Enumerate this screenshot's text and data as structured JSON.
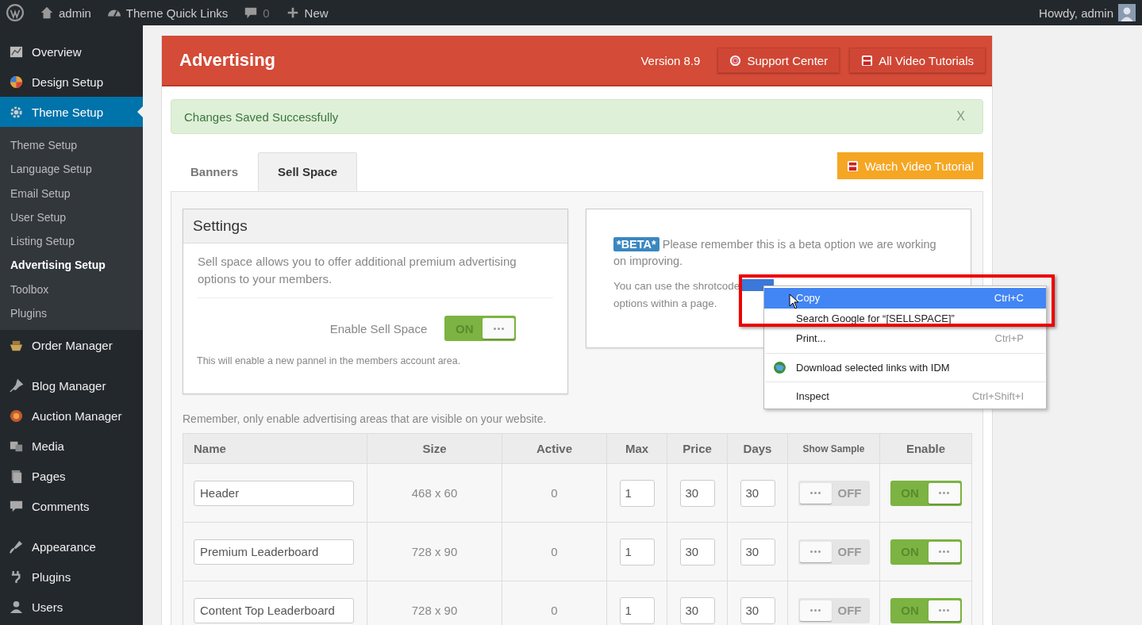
{
  "admin_bar": {
    "items": [
      {
        "kind": "wp"
      },
      {
        "kind": "home",
        "label": "admin"
      },
      {
        "kind": "gauge",
        "label": "Theme Quick Links"
      },
      {
        "kind": "comment",
        "label": "0"
      },
      {
        "kind": "plus",
        "label": "New"
      }
    ],
    "greeting": "Howdy, admin"
  },
  "sidebar": {
    "items": [
      {
        "kind": "chart",
        "label": "Overview",
        "selected": false
      },
      {
        "kind": "palette",
        "label": "Design Setup",
        "selected": false
      },
      {
        "kind": "gear",
        "label": "Theme Setup",
        "selected": true,
        "children": [
          {
            "label": "Theme Setup",
            "selected": false
          },
          {
            "label": "Language Setup",
            "selected": false
          },
          {
            "label": "Email Setup",
            "selected": false
          },
          {
            "label": "User Setup",
            "selected": false
          },
          {
            "label": "Listing Setup",
            "selected": false
          },
          {
            "label": "Advertising Setup",
            "selected": true
          },
          {
            "label": "Toolbox",
            "selected": false
          },
          {
            "label": "Plugins",
            "selected": false
          }
        ]
      },
      {
        "kind": "basket",
        "label": "Order Manager",
        "selected": false
      },
      {
        "kind": "separator"
      },
      {
        "kind": "pin",
        "label": "Blog Manager",
        "selected": false
      },
      {
        "kind": "ball",
        "label": "Auction Manager",
        "selected": false
      },
      {
        "kind": "media",
        "label": "Media",
        "selected": false
      },
      {
        "kind": "pages",
        "label": "Pages",
        "selected": false
      },
      {
        "kind": "comment",
        "label": "Comments",
        "selected": false
      },
      {
        "kind": "separator"
      },
      {
        "kind": "brush",
        "label": "Appearance",
        "selected": false
      },
      {
        "kind": "plug",
        "label": "Plugins",
        "selected": false
      },
      {
        "kind": "user",
        "label": "Users",
        "selected": false
      }
    ]
  },
  "header": {
    "title": "Advertising",
    "version": "Version 8.9",
    "buttons": [
      {
        "kind": "support",
        "label": "Support Center"
      },
      {
        "kind": "video",
        "label": "All Video Tutorials"
      }
    ]
  },
  "alert": {
    "message": "Changes Saved Successfully",
    "close": "X"
  },
  "tabs": [
    {
      "label": "Banners",
      "selected": false
    },
    {
      "label": "Sell Space",
      "selected": true
    }
  ],
  "watch_button": "Watch Video Tutorial",
  "settings": {
    "title": "Settings",
    "description": "Sell space allows you to offer additional premium advertising options to your members.",
    "toggle_label": "Enable Sell Space",
    "toggle": {
      "on": true,
      "label": "ON"
    },
    "note": "This will enable a new pannel in the members account area."
  },
  "beta": {
    "badge": "*BETA*",
    "text": "Please remember this is a beta option we are working",
    "text_continued": "on improving.",
    "shortcode_text": "You can use the shrotcode",
    "shortcode_end": "options within a page."
  },
  "table_note": "Remember, only enable advertising areas that are visible on your website.",
  "table": {
    "columns": [
      "Name",
      "Size",
      "Active",
      "Max",
      "Price",
      "Days",
      "Show Sample",
      "Enable"
    ],
    "rows": [
      {
        "name": "Header",
        "size": "468 x 60",
        "active": "0",
        "max": "1",
        "price": "30",
        "days": "30",
        "show_sample": false,
        "show_sample_label": "OFF",
        "enable": true,
        "enable_label": "ON"
      },
      {
        "name": "Premium Leaderboard",
        "size": "728 x 90",
        "active": "0",
        "max": "1",
        "price": "30",
        "days": "30",
        "show_sample": false,
        "show_sample_label": "OFF",
        "enable": true,
        "enable_label": "ON"
      },
      {
        "name": "Content Top Leaderboard",
        "size": "728 x 90",
        "active": "0",
        "max": "1",
        "price": "30",
        "days": "30",
        "show_sample": false,
        "show_sample_label": "OFF",
        "enable": true,
        "enable_label": "ON"
      }
    ]
  },
  "context_menu": {
    "items": [
      {
        "kind": "item",
        "label": "Copy",
        "shortcut": "Ctrl+C",
        "selected": true,
        "icon": false
      },
      {
        "kind": "item",
        "label": "Search Google for “[SELLSPACE]”",
        "selected": false,
        "icon": false
      },
      {
        "kind": "item",
        "label": "Print...",
        "shortcut": "Ctrl+P",
        "selected": false,
        "icon": false
      },
      {
        "kind": "separator"
      },
      {
        "kind": "item",
        "label": "Download selected links with IDM",
        "selected": false,
        "icon": true
      },
      {
        "kind": "separator"
      },
      {
        "kind": "item",
        "label": "Inspect",
        "shortcut": "Ctrl+Shift+I",
        "selected": false,
        "icon": false
      }
    ]
  }
}
